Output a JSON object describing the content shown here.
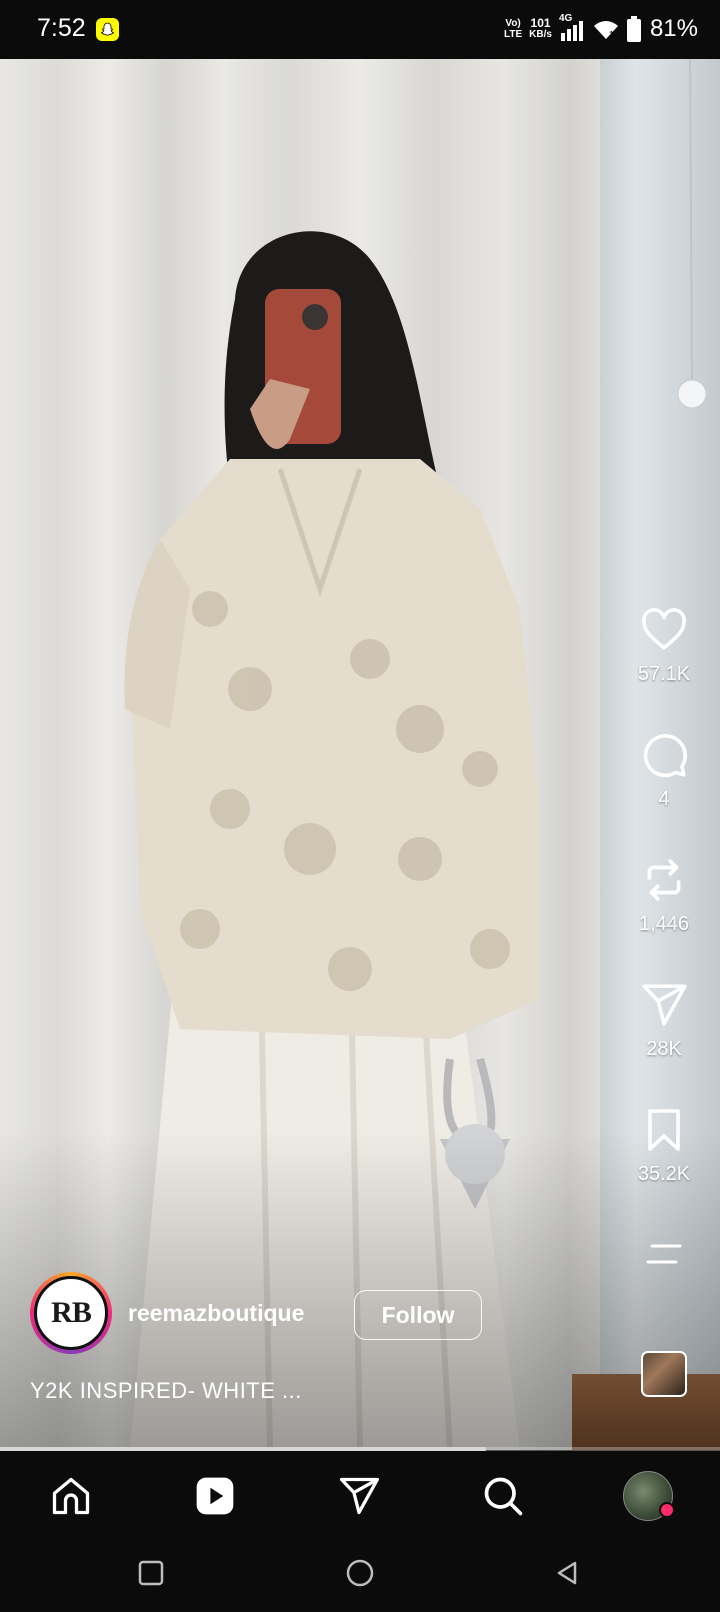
{
  "status_bar": {
    "time": "7:52",
    "net_top": "Vo)",
    "net_bottom": "LTE",
    "speed_top": "101",
    "speed_bottom": "KB/s",
    "signal_type": "4G",
    "battery": "81%"
  },
  "reel": {
    "actions": {
      "likes": "57.1K",
      "comments": "4",
      "reposts": "1,446",
      "shares": "28K",
      "saves": "35.2K"
    },
    "author": {
      "avatar_text": "RB",
      "username": "reemazboutique",
      "follow_label": "Follow"
    },
    "caption": "Y2K INSPIRED- WHITE ...",
    "progress": 0.675
  },
  "icons": {
    "like": "heart-icon",
    "comment": "comment-icon",
    "repost": "repost-icon",
    "share": "send-icon",
    "save": "bookmark-icon",
    "more": "more-icon",
    "home": "home-icon",
    "reels": "reels-icon",
    "messages": "send-icon",
    "search": "search-icon"
  },
  "colors": {
    "background": "#0b0b0c",
    "snapchat": "#fffc00",
    "notification": "#ff2a6a"
  }
}
